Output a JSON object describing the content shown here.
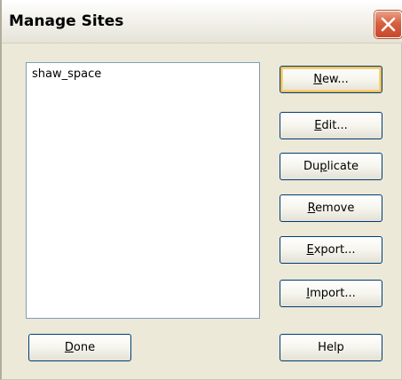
{
  "window": {
    "title": "Manage Sites",
    "close_icon": "close-icon"
  },
  "sites": {
    "items": [
      "shaw_space"
    ]
  },
  "buttons": {
    "new": {
      "pre": "",
      "mnemonic": "N",
      "post": "ew..."
    },
    "edit": {
      "pre": "",
      "mnemonic": "E",
      "post": "dit..."
    },
    "duplicate": {
      "pre": "Du",
      "mnemonic": "p",
      "post": "licate"
    },
    "remove": {
      "pre": "",
      "mnemonic": "R",
      "post": "emove"
    },
    "export": {
      "pre": "",
      "mnemonic": "E",
      "post": "xport..."
    },
    "import": {
      "pre": "",
      "mnemonic": "I",
      "post": "mport..."
    },
    "done": {
      "pre": "",
      "mnemonic": "D",
      "post": "one"
    },
    "help": {
      "pre": "",
      "mnemonic": "",
      "post": "Help"
    }
  },
  "colors": {
    "dialog_bg": "#ece9d8",
    "close_red": "#d7613f",
    "button_border": "#003c74",
    "default_focus": "#f0c05a"
  }
}
